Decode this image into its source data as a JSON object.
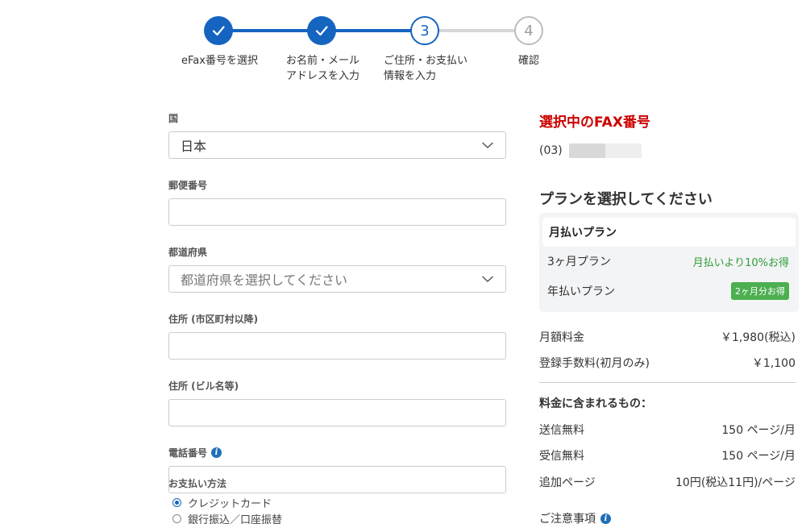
{
  "stepper": {
    "steps": [
      {
        "number": "",
        "label_line1": "eFax番号を選択",
        "label_line2": "",
        "state": "done"
      },
      {
        "number": "",
        "label_line1": "お名前・メール",
        "label_line2": "アドレスを入力",
        "state": "done"
      },
      {
        "number": "3",
        "label_line1": "ご住所・お支払い",
        "label_line2": "情報を入力",
        "state": "active"
      },
      {
        "number": "4",
        "label_line1": "確認",
        "label_line2": "",
        "state": "todo"
      }
    ]
  },
  "form": {
    "country": {
      "label": "国",
      "value": "日本"
    },
    "postal": {
      "label": "郵便番号",
      "value": ""
    },
    "prefecture": {
      "label": "都道府県",
      "placeholder": "都道府県を選択してください"
    },
    "address1": {
      "label": "住所 (市区町村以降)",
      "value": ""
    },
    "address2": {
      "label": "住所 (ビル名等)",
      "value": ""
    },
    "phone": {
      "label": "電話番号",
      "value": ""
    },
    "payment": {
      "label": "お支払い方法",
      "options": [
        "クレジットカード",
        "銀行振込／口座振替"
      ],
      "selected": "クレジットカード"
    }
  },
  "summary": {
    "fax_title": "選択中のFAX番号",
    "fax_prefix": "(03)",
    "plan_title": "プランを選択してください",
    "plan_group": "月払いプラン",
    "plans": [
      {
        "name": "3ヶ月プラン",
        "note": "月払いより10%お得"
      },
      {
        "name": "年払いプラン",
        "badge": "2ヶ月分お得"
      }
    ],
    "monthly_label": "月額料金",
    "monthly_value": "￥1,980(税込)",
    "reg_label": "登録手数料(初月のみ)",
    "reg_value": "￥1,100",
    "included_title": "料金に含まれるもの：",
    "included": [
      {
        "label": "送信無料",
        "value": "150 ページ/月"
      },
      {
        "label": "受信無料",
        "value": "150 ページ/月"
      },
      {
        "label": "追加ページ",
        "value": "10円(税込11円)/ページ"
      }
    ],
    "notes_label": "ご注意事項"
  },
  "colors": {
    "primary": "#1565c0",
    "accent_red": "#cc0000",
    "green": "#4caf50"
  }
}
